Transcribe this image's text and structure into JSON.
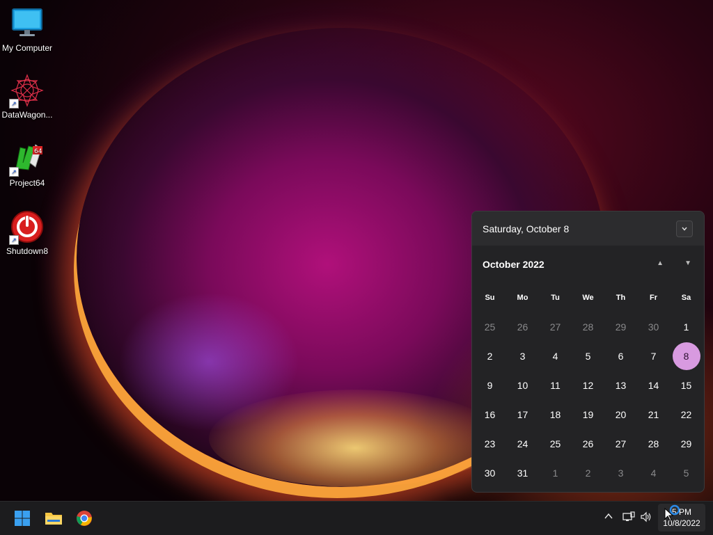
{
  "desktop": {
    "icons": [
      {
        "label": "My Computer",
        "icon": "monitor-icon"
      },
      {
        "label": "DataWagon...",
        "icon": "datawagon-icon"
      },
      {
        "label": "Project64",
        "icon": "project64-icon"
      },
      {
        "label": "Shutdown8",
        "icon": "power-icon"
      }
    ]
  },
  "calendar": {
    "header_date": "Saturday, October 8",
    "month_label": "October 2022",
    "weekdays": [
      "Su",
      "Mo",
      "Tu",
      "We",
      "Th",
      "Fr",
      "Sa"
    ],
    "weeks": [
      [
        "25",
        "26",
        "27",
        "28",
        "29",
        "30",
        "1"
      ],
      [
        "2",
        "3",
        "4",
        "5",
        "6",
        "7",
        "8"
      ],
      [
        "9",
        "10",
        "11",
        "12",
        "13",
        "14",
        "15"
      ],
      [
        "16",
        "17",
        "18",
        "19",
        "20",
        "21",
        "22"
      ],
      [
        "23",
        "24",
        "25",
        "26",
        "27",
        "28",
        "29"
      ],
      [
        "30",
        "31",
        "1",
        "2",
        "3",
        "4",
        "5"
      ]
    ],
    "today": "8",
    "colors": {
      "today_bg": "#d89ae0",
      "panel_bg": "#232325"
    }
  },
  "taskbar": {
    "apps": [
      {
        "name": "start",
        "icon": "windows-icon"
      },
      {
        "name": "file-explorer",
        "icon": "folder-icon"
      },
      {
        "name": "chrome",
        "icon": "chrome-icon"
      }
    ],
    "tray": {
      "chevron": "^",
      "network_icon": "network-icon",
      "volume_icon": "volume-icon"
    },
    "clock": {
      "time": "5 PM",
      "date": "10/8/2022"
    }
  }
}
